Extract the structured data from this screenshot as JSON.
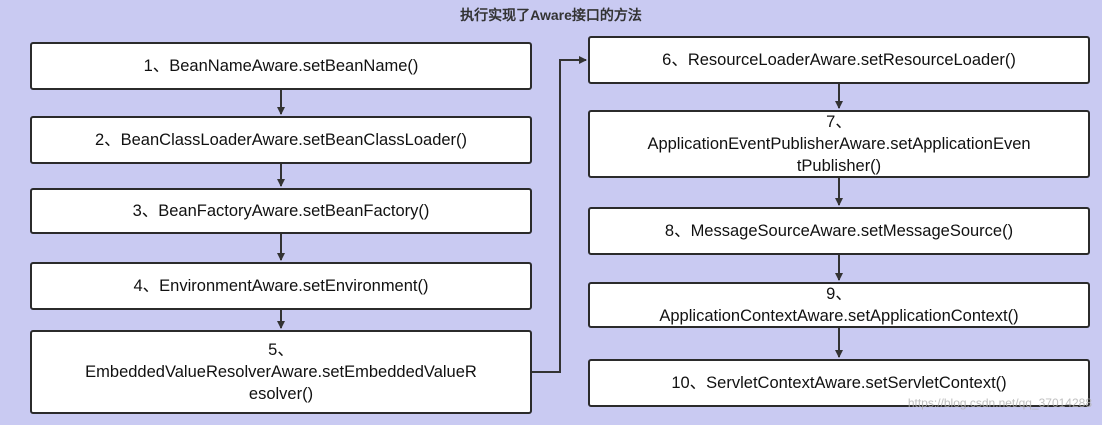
{
  "title": "执行实现了Aware接口的方法",
  "steps": [
    {
      "lines": [
        "1、BeanNameAware.setBeanName()"
      ]
    },
    {
      "lines": [
        "2、BeanClassLoaderAware.setBeanClassLoader()"
      ]
    },
    {
      "lines": [
        "3、BeanFactoryAware.setBeanFactory()"
      ]
    },
    {
      "lines": [
        "4、EnvironmentAware.setEnvironment()"
      ]
    },
    {
      "lines": [
        "5、",
        "EmbeddedValueResolverAware.setEmbeddedValueR",
        "esolver()"
      ]
    },
    {
      "lines": [
        "6、ResourceLoaderAware.setResourceLoader()"
      ]
    },
    {
      "lines": [
        "7、",
        "ApplicationEventPublisherAware.setApplicationEven",
        "tPublisher()"
      ]
    },
    {
      "lines": [
        "8、MessageSourceAware.setMessageSource()"
      ]
    },
    {
      "lines": [
        "9、",
        "ApplicationContextAware.setApplicationContext()"
      ]
    },
    {
      "lines": [
        "10、ServletContextAware.setServletContext()"
      ]
    }
  ],
  "watermark": "https://blog.csdn.net/qq_37014288"
}
